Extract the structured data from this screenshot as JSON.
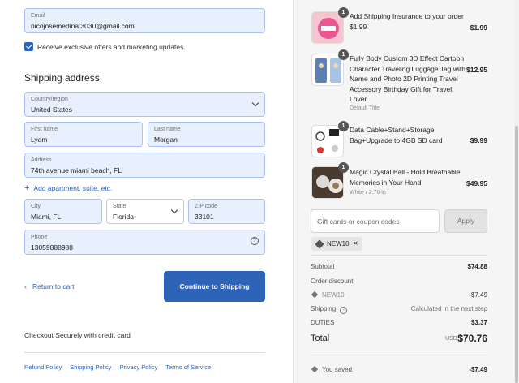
{
  "contact": {
    "email_label": "Email",
    "email_value": "nicojosemedina.3030@gmail.com",
    "marketing_label": "Receive exclusive offers and marketing updates"
  },
  "shipping": {
    "title": "Shipping address",
    "country_label": "Country/region",
    "country_value": "United States",
    "first_label": "First name",
    "first_value": "Lyam",
    "last_label": "Last name",
    "last_value": "Morgan",
    "address_label": "Address",
    "address_value": "74th avenue miami beach, FL",
    "add_apartment": "Add apartment, suite, etc.",
    "city_label": "City",
    "city_value": "Miami, FL",
    "state_label": "State",
    "state_value": "Florida",
    "zip_label": "ZIP code",
    "zip_value": "33101",
    "phone_label": "Phone",
    "phone_value": "13059888988"
  },
  "actions": {
    "return": "Return to cart",
    "continue": "Continue to Shipping",
    "secure": "Checkout Securely with credit card"
  },
  "policies": [
    "Refund Policy",
    "Shipping Policy",
    "Privacy Policy",
    "Terms of Service"
  ],
  "items": [
    {
      "qty": "1",
      "name": "Add Shipping Insurance to your order",
      "sub": "$1.99",
      "price": "$1.99",
      "icon": "shipping-insurance-icon"
    },
    {
      "qty": "1",
      "name": "Fully Body Custom 3D Effect Cartoon Character Traveling Luggage Tag with Name and Photo 2D Printing Travel Accessory Birthday Gift for Travel Lover",
      "sub": "Default Title",
      "price": "$12.95",
      "icon": "luggage-tag-image"
    },
    {
      "qty": "1",
      "name": "Data Cable+Stand+Storage Bag+Upgrade to 4GB SD card",
      "sub": "",
      "price": "$9.99",
      "icon": "data-cable-image"
    },
    {
      "qty": "1",
      "name": "Magic Crystal Ball - Hold Breathable Memories in Your Hand",
      "sub": "White / 2.76 in",
      "price": "$49.95",
      "icon": "crystal-ball-image"
    }
  ],
  "coupon": {
    "placeholder": "Gift cards or coupon codes",
    "apply": "Apply",
    "applied_code": "NEW10"
  },
  "summary": {
    "subtotal_label": "Subtotal",
    "subtotal_value": "$74.88",
    "discount_label": "Order discount",
    "discount_code": "NEW10",
    "discount_value": "-$7.49",
    "shipping_label": "Shipping",
    "shipping_value": "Calculated in the next step",
    "duties_label": "DUTIES",
    "duties_value": "$3.37",
    "total_label": "Total",
    "total_currency": "USD",
    "total_value": "$70.76",
    "saved_label": "You saved",
    "saved_value": "-$7.49"
  },
  "colors": {
    "accent": "#2d64b8",
    "autofill": "#e8f0fe"
  }
}
